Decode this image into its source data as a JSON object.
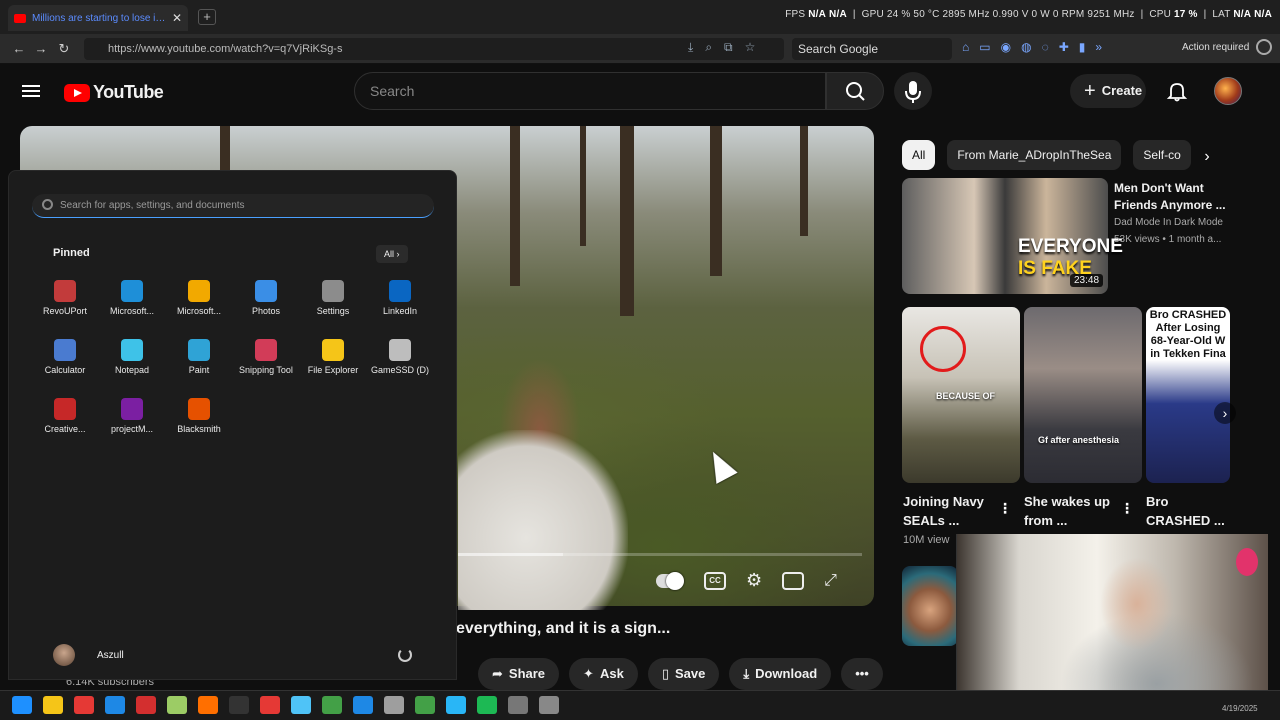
{
  "browser": {
    "tab_title": "Millions are starting to lose interest",
    "url": "https://www.youtube.com/watch?v=q7VjRiKSg-s",
    "search_engine_label": "Search Google",
    "action_required": "Action required"
  },
  "osd": {
    "fps_label": "FPS",
    "fps_value": "N/A",
    "fps_value2": "N/A",
    "gpu_label": "GPU",
    "gpu_stats": "24 % 50 °C 2895 MHz 0.990 V 0 W 0 RPM 9251 MHz",
    "cpu_label": "CPU",
    "cpu_value": "17 %",
    "lat_label": "LAT",
    "lat_value": "N/A",
    "lat_value2": "N/A"
  },
  "youtube": {
    "brand": "YouTube",
    "search_placeholder": "Search",
    "create_label": "Create"
  },
  "video": {
    "title_visible": "everything, and it is a sign...",
    "subscribers": "6.14K subscribers",
    "actions": [
      {
        "icon": "share-icon",
        "label": "Share"
      },
      {
        "icon": "sparkle-icon",
        "label": "Ask"
      },
      {
        "icon": "bookmark-icon",
        "label": "Save"
      },
      {
        "icon": "download-icon",
        "label": "Download"
      }
    ],
    "progress_fraction": 0.26
  },
  "chips": [
    "All",
    "From Marie_ADropInTheSea",
    "Self-co"
  ],
  "recommended": {
    "title": "Men Don't Want Friends Anymore ...",
    "channel": "Dad Mode In Dark Mode",
    "meta": "53K views • 1 month a...",
    "duration": "23:48",
    "thumb_text1": "EVERYONE",
    "thumb_text2": "IS FAKE"
  },
  "shorts": [
    {
      "title": "Joining Navy SEALs ...",
      "views": "10M view",
      "overlay": "BECAUSE OF"
    },
    {
      "title": "She wakes up from ...",
      "overlay": "Gf after anesthesia"
    },
    {
      "title": "Bro CRASHED ...",
      "overlay": "Bro CRASHED After Losing 68-Year-Old W in Tekken Fina"
    }
  ],
  "start_menu": {
    "search_placeholder": "Search for apps, settings, and documents",
    "pinned_label": "Pinned",
    "all_label": "All",
    "apps": [
      {
        "label": "RevoUPort",
        "color": "#c23b3b"
      },
      {
        "label": "Microsoft...",
        "color": "#1e8fd8"
      },
      {
        "label": "Microsoft...",
        "color": "#f2a900"
      },
      {
        "label": "Photos",
        "color": "#3a8ee6"
      },
      {
        "label": "Settings",
        "color": "#8c8c8c"
      },
      {
        "label": "LinkedIn",
        "color": "#0a66c2"
      },
      {
        "label": "Calculator",
        "color": "#4a7bd0"
      },
      {
        "label": "Notepad",
        "color": "#3ec2e8"
      },
      {
        "label": "Paint",
        "color": "#2fa3d6"
      },
      {
        "label": "Snipping Tool",
        "color": "#d23c58"
      },
      {
        "label": "File Explorer",
        "color": "#f5c518"
      },
      {
        "label": "GameSSD (D)",
        "color": "#bdbdbd"
      },
      {
        "label": "Creative...",
        "color": "#c62828"
      },
      {
        "label": "projectM...",
        "color": "#7b1fa2"
      },
      {
        "label": "Blacksmith",
        "color": "#e65100"
      }
    ],
    "user_name": "Aszull"
  },
  "taskbar": {
    "date": "4/19/2025",
    "icon_colors": [
      "#1e90ff",
      "#f5c518",
      "#e53935",
      "#1e88e5",
      "#d32f2f",
      "#9ccc65",
      "#ff6f00",
      "#333333",
      "#e53935",
      "#4fc3f7",
      "#43a047",
      "#1e88e5",
      "#9e9e9e",
      "#43a047",
      "#29b6f6",
      "#1db954",
      "#777777",
      "#888888"
    ]
  }
}
